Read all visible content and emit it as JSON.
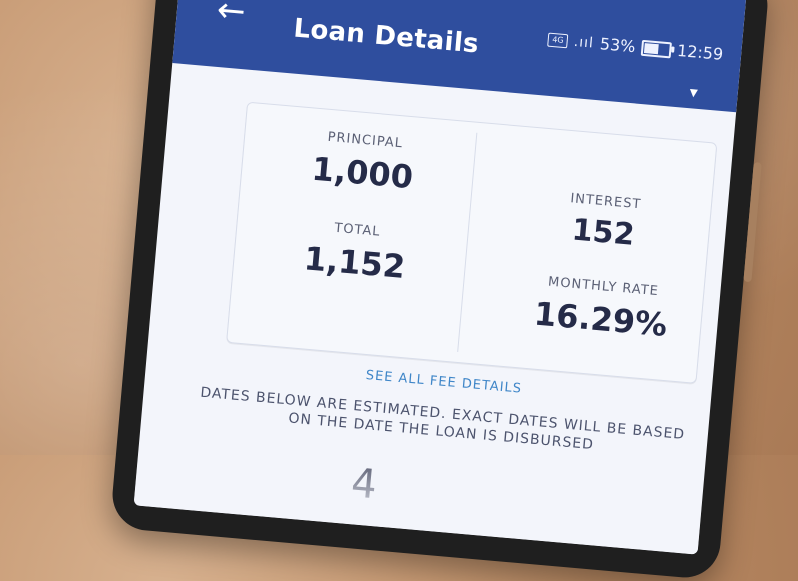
{
  "header": {
    "title": "Loan Details",
    "back_icon": "←",
    "status": {
      "battery": "53%",
      "time": "12:59",
      "network": "4G",
      "signal": ".ııl"
    },
    "caret": "▾"
  },
  "summary": {
    "principal_label": "PRINCIPAL",
    "principal_value": "1,000",
    "total_label": "TOTAL",
    "total_value": "1,152",
    "interest_label": "INTEREST",
    "interest_value": "152",
    "monthly_rate_label": "MONTHLY RATE",
    "monthly_rate_value": "16.29%"
  },
  "link": {
    "see_all_fees": "SEE ALL FEE DETAILS"
  },
  "notice": {
    "line1": "DATES BELOW ARE ESTIMATED. EXACT DATES WILL BE BASED",
    "line2": "ON THE DATE THE LOAN IS DISBURSED"
  },
  "partial": {
    "number": "4"
  },
  "colors": {
    "header": "#2f4e9e",
    "accent_link": "#3f86c8",
    "text_dark": "#252b48",
    "text_muted": "#5b6075",
    "background_screen": "#f3f5fb"
  }
}
